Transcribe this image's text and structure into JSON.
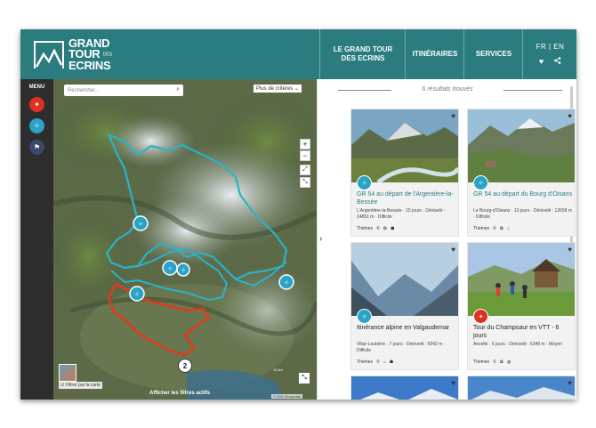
{
  "header": {
    "logo_line1": "GRAND",
    "logo_line2": "TOUR",
    "logo_small": "DES",
    "logo_line3": "ECRINS",
    "nav": [
      {
        "label": "LE GRAND TOUR DES ECRINS"
      },
      {
        "label": "ITINÉRAIRES"
      },
      {
        "label": "SERVICES"
      }
    ],
    "lang_fr": "FR",
    "lang_sep": "|",
    "lang_en": "EN",
    "heart_icon": "heart-icon",
    "share_icon": "share-icon"
  },
  "sidebar": {
    "menu_label": "MENU",
    "buttons": [
      {
        "icon": "hiker-icon",
        "color": "#e0301e"
      },
      {
        "icon": "walker-icon",
        "color": "#2aa3c7"
      },
      {
        "icon": "flag-icon",
        "color": "#3a4a6b"
      }
    ]
  },
  "map": {
    "search_placeholder": "Rechercher...",
    "criteria_label": "Plus de critères",
    "zoom_in": "+",
    "zoom_out": "−",
    "cluster_count": "2",
    "filter_checkbox_label": "Filtrer par la carte",
    "active_filters": "Afficher les filtres actifs",
    "scale": "10 km",
    "attribution": "© IGN Géoportail",
    "route_colors": {
      "blue": "#2ab3c8",
      "red": "#e23a1c"
    }
  },
  "results": {
    "count_text": "6 résultats trouvés",
    "cards": [
      {
        "title": "GR 54 au départ de l'Argentière-la-Bessée",
        "meta": "L'Argentière-la-Bessée · 15 jours · Dénivelé : 14851 m · Difficile",
        "themes_label": "Thèmes",
        "badge_color": "#2aa3c7",
        "title_color": "#2b7c7e"
      },
      {
        "title": "GR 54 au départ du Bourg d'Oisans",
        "meta": "Le Bourg-d'Oisans · 13 jours · Dénivelé : 13558 m · Difficile",
        "themes_label": "Thèmes",
        "badge_color": "#2aa3c7",
        "title_color": "#2b7c7e"
      },
      {
        "title": "Itinérance alpine en Valgaudemar",
        "meta": "Villar-Loubière · 7 jours · Dénivelé : 6042 m · Difficile",
        "themes_label": "Thèmes",
        "badge_color": "#2aa3c7",
        "title_color": "#222222"
      },
      {
        "title": "Tour du Champsaur en VTT - 6 jours",
        "meta": "Ancelle · 6 jours · Dénivelé : 6349 m · Moyen",
        "themes_label": "Thèmes",
        "badge_color": "#e0301e",
        "title_color": "#222222"
      }
    ]
  }
}
